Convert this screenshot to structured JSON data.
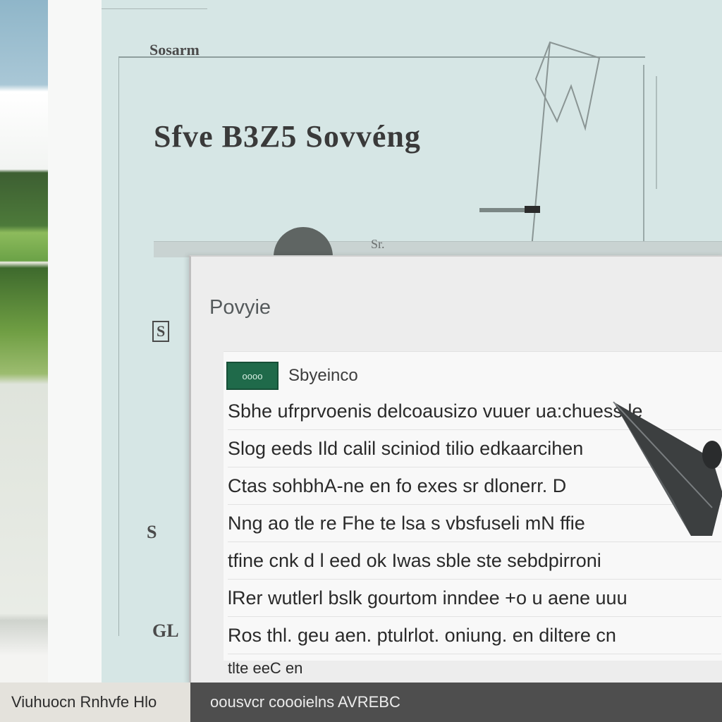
{
  "background_window": {
    "small_label": "Sosarm",
    "heading": "Sfve B3Z5 Sovvéng",
    "ledge_label": "Sr.",
    "side_glyphs": [
      "S",
      "S",
      "GL"
    ]
  },
  "dialog": {
    "title": "Povyie",
    "tag_badge": "oooo",
    "tag_label": "Sbyeinco",
    "lines": [
      "Sbhe ufrprvoenis delcoausizo vuuer ua:chuess.le",
      "Slog eeds Ild calil sciniod tilio edkaarcihen",
      "Ctas sohbhA-ne en fo exes sr dlonerr. D",
      "Nng ao tle re Fhe te lsa s vbsfuseli mN ffie",
      "tfine cnk d l eed ok Iwas sble ste sebdpirroni",
      "lRer wutlerl bslk gourtom inndee +o u aene uuu",
      "Ros thl. geu aen. ptulrlot. oniung. en diltere cn",
      "tlte eeC en"
    ]
  },
  "taskbar": {
    "left_label": "Viuhuocn Rnhvfe Hlo",
    "right_label": "oousvcr coooielns AVREBC"
  },
  "colors": {
    "badge": "#1f6a4a",
    "back_panel": "#d6e6e5",
    "taskbar": "#4e4e4e"
  }
}
